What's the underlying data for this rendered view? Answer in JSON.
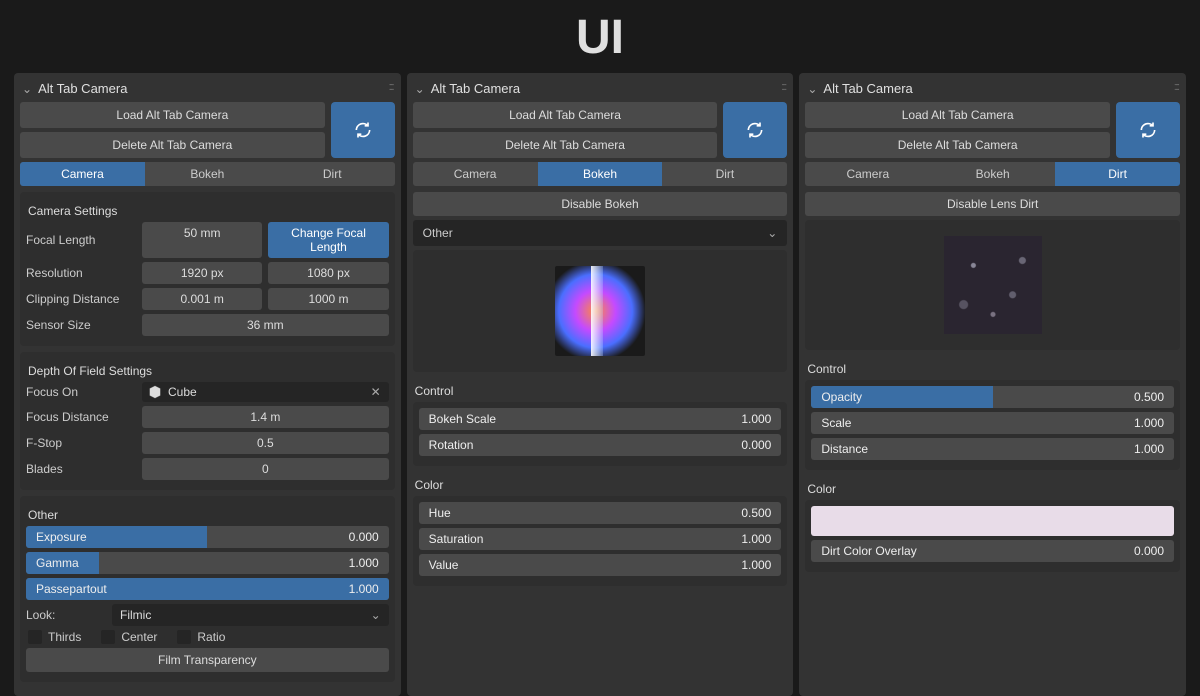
{
  "page_title": "UI",
  "panel_title": "Alt Tab Camera",
  "buttons": {
    "load": "Load Alt Tab Camera",
    "delete": "Delete Alt Tab Camera",
    "change_focal": "Change Focal Length",
    "disable_bokeh": "Disable Bokeh",
    "disable_dirt": "Disable Lens Dirt",
    "film_transparency": "Film Transparency"
  },
  "tabs": {
    "camera": "Camera",
    "bokeh": "Bokeh",
    "dirt": "Dirt"
  },
  "camera": {
    "sections": {
      "camera_settings": "Camera Settings",
      "dof_settings": "Depth Of Field Settings",
      "other": "Other"
    },
    "labels": {
      "focal_length": "Focal Length",
      "resolution": "Resolution",
      "clipping": "Clipping Distance",
      "sensor": "Sensor Size",
      "focus_on": "Focus On",
      "focus_distance": "Focus Distance",
      "fstop": "F-Stop",
      "blades": "Blades",
      "look": "Look:"
    },
    "values": {
      "focal_length": "50 mm",
      "res_x": "1920 px",
      "res_y": "1080 px",
      "clip_near": "0.001 m",
      "clip_far": "1000 m",
      "sensor": "36 mm",
      "focus_object": "Cube",
      "focus_distance": "1.4 m",
      "fstop": "0.5",
      "blades": "0",
      "look_selected": "Filmic"
    },
    "sliders": {
      "exposure": {
        "label": "Exposure",
        "value": "0.000",
        "fill": 50
      },
      "gamma": {
        "label": "Gamma",
        "value": "1.000",
        "fill": 20
      },
      "passepartout": {
        "label": "Passepartout",
        "value": "1.000",
        "fill": 100
      }
    },
    "checks": {
      "thirds": "Thirds",
      "center": "Center",
      "ratio": "Ratio"
    }
  },
  "bokeh": {
    "other_label": "Other",
    "sections": {
      "control": "Control",
      "color": "Color"
    },
    "sliders": {
      "scale": {
        "label": "Bokeh Scale",
        "value": "1.000",
        "fill": 0
      },
      "rotation": {
        "label": "Rotation",
        "value": "0.000",
        "fill": 0
      },
      "hue": {
        "label": "Hue",
        "value": "0.500",
        "fill": 0
      },
      "saturation": {
        "label": "Saturation",
        "value": "1.000",
        "fill": 0
      },
      "value": {
        "label": "Value",
        "value": "1.000",
        "fill": 0
      }
    }
  },
  "dirt": {
    "sections": {
      "control": "Control",
      "color": "Color"
    },
    "sliders": {
      "opacity": {
        "label": "Opacity",
        "value": "0.500",
        "fill": 50
      },
      "scale": {
        "label": "Scale",
        "value": "1.000",
        "fill": 0
      },
      "distance": {
        "label": "Distance",
        "value": "1.000",
        "fill": 0
      },
      "overlay": {
        "label": "Dirt Color Overlay",
        "value": "0.000",
        "fill": 0
      }
    }
  }
}
